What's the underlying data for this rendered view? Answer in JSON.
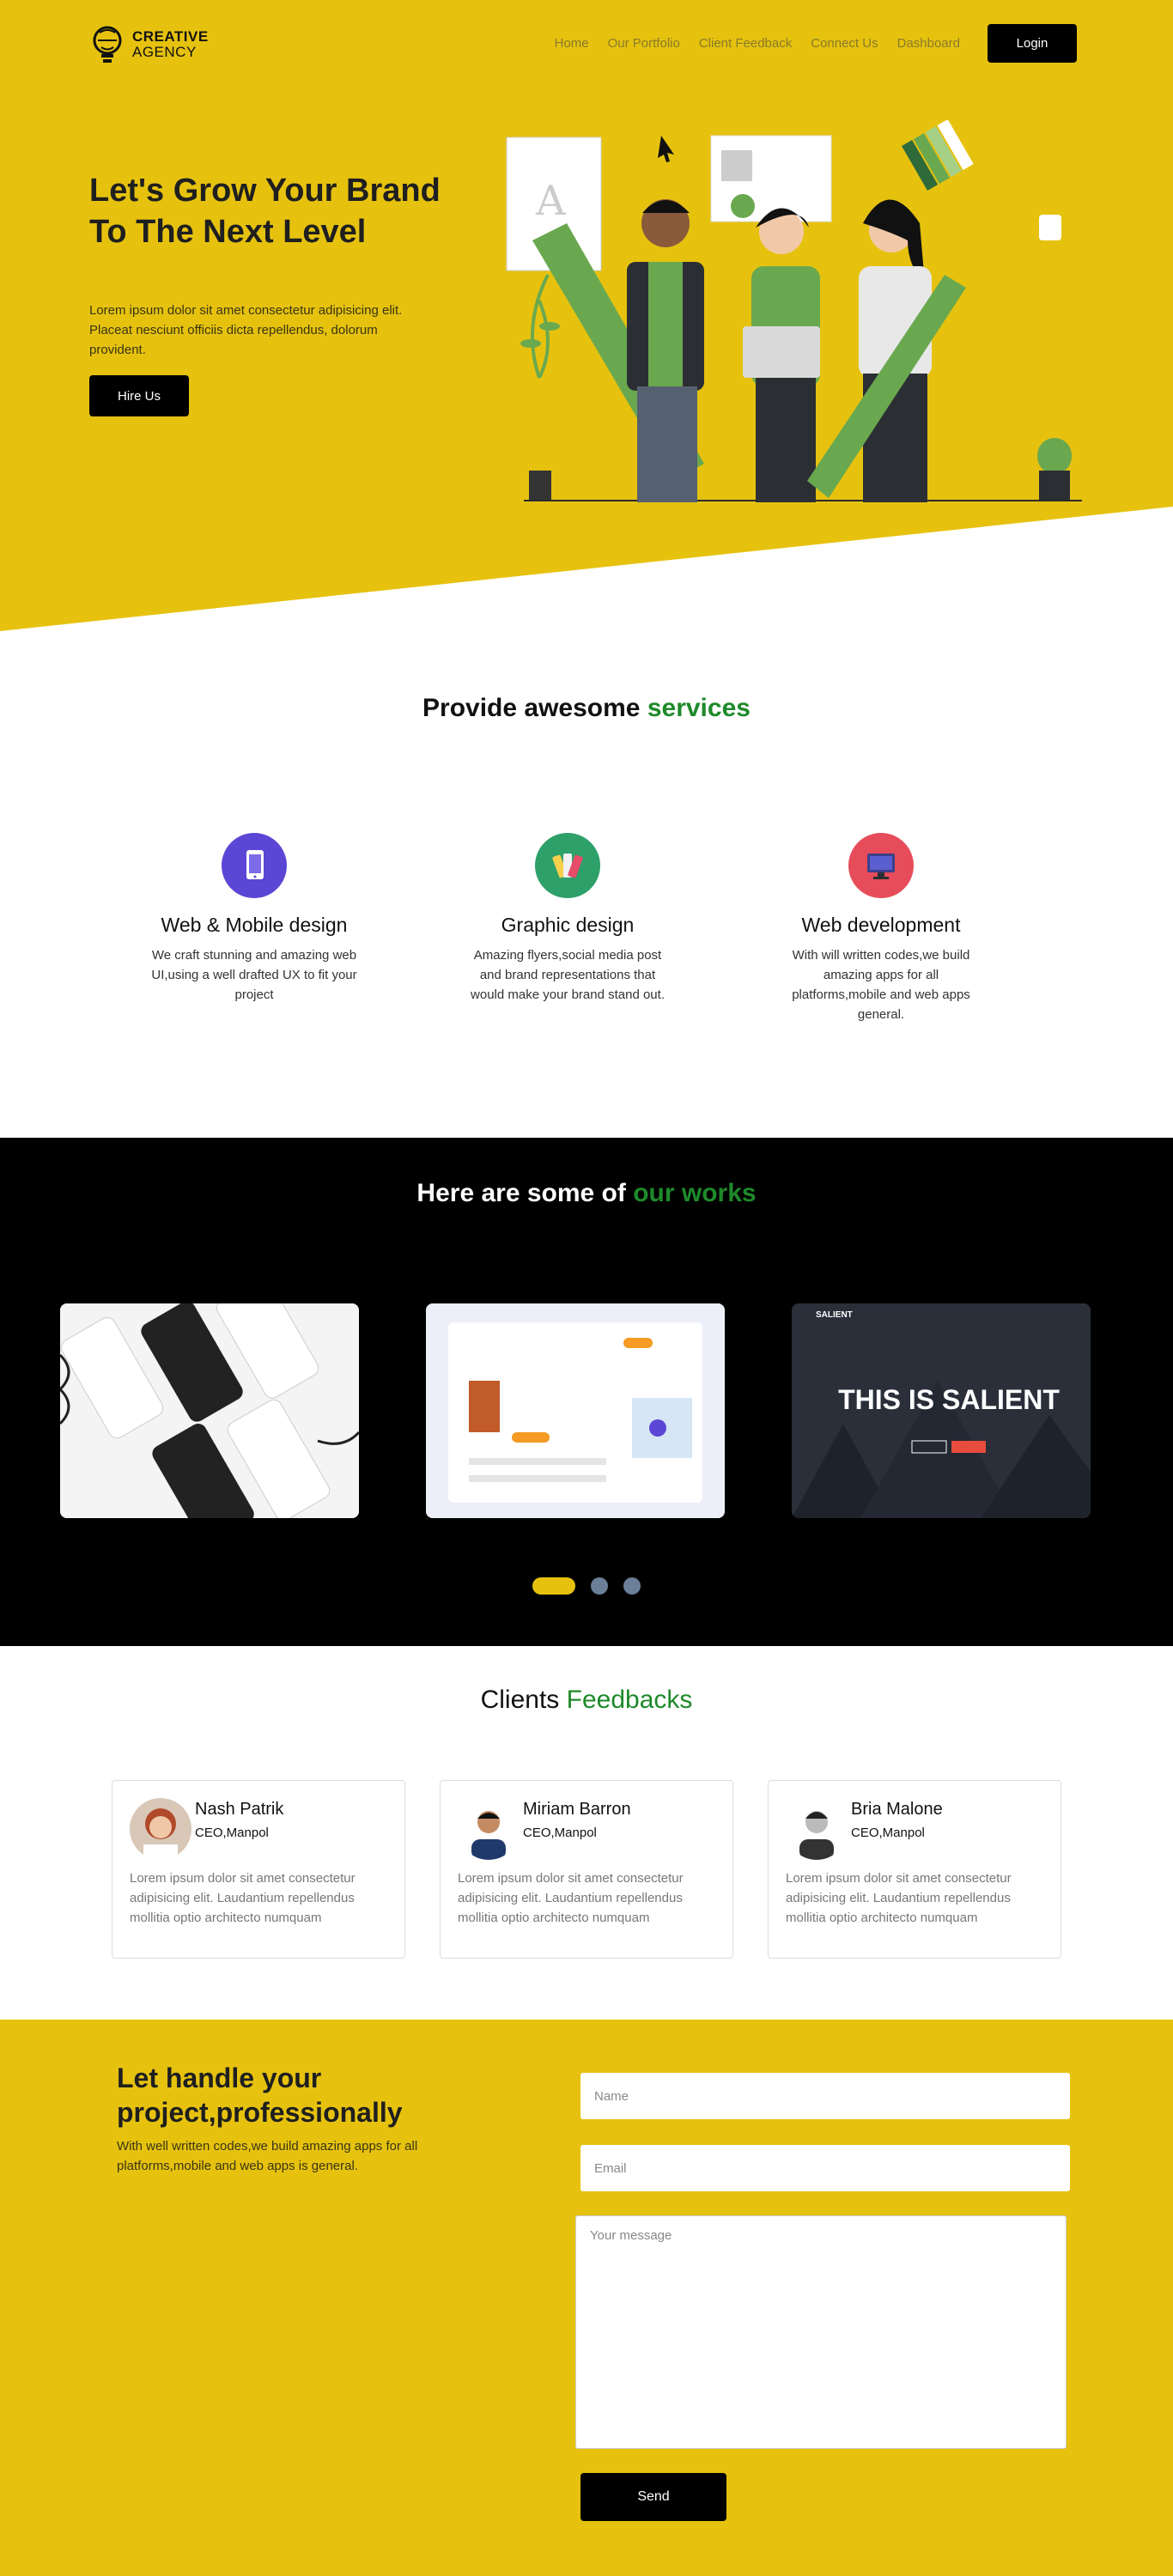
{
  "brand": {
    "line1": "CREATIVE",
    "line2": "AGENCY"
  },
  "nav": {
    "items": [
      "Home",
      "Our Portfolio",
      "Client Feedback",
      "Connect Us",
      "Dashboard"
    ],
    "login_label": "Login"
  },
  "hero": {
    "title": "Let's Grow Your Brand To The Next Level",
    "description": "Lorem ipsum dolor sit amet consectetur adipisicing elit. Placeat nesciunt officiis dicta repellendus, dolorum provident.",
    "cta_label": "Hire Us"
  },
  "services": {
    "title_main": "Provide awesome ",
    "title_accent": "services",
    "items": [
      {
        "title": "Web & Mobile design",
        "text": "We craft stunning and amazing web UI,using a well drafted UX to fit your project",
        "icon": "mobile-design-icon"
      },
      {
        "title": "Graphic design",
        "text": "Amazing flyers,social media post and brand representations that would make your brand stand out.",
        "icon": "color-palette-icon"
      },
      {
        "title": "Web development",
        "text": "With will written codes,we build amazing apps for all platforms,mobile and web apps general.",
        "icon": "monitor-code-icon"
      }
    ]
  },
  "works": {
    "title_main": "Here are some of ",
    "title_accent": "our works",
    "card3_heading": "THIS IS SALIENT",
    "card3_brand": "SALIENT"
  },
  "feedback": {
    "title_main": "Clients ",
    "title_accent": "Feedbacks",
    "items": [
      {
        "name": "Nash Patrik",
        "role": "CEO,Manpol",
        "text": "Lorem ipsum dolor sit amet consectetur adipisicing elit. Laudantium repellendus mollitia optio architecto numquam"
      },
      {
        "name": "Miriam Barron",
        "role": "CEO,Manpol",
        "text": "Lorem ipsum dolor sit amet consectetur adipisicing elit. Laudantium repellendus mollitia optio architecto numquam"
      },
      {
        "name": "Bria Malone",
        "role": "CEO,Manpol",
        "text": "Lorem ipsum dolor sit amet consectetur adipisicing elit. Laudantium repellendus mollitia optio architecto numquam"
      }
    ]
  },
  "contact": {
    "title": "Let handle your project,professionally",
    "description": "With well written codes,we build amazing apps for all platforms,mobile and web apps is general.",
    "name_placeholder": "Name",
    "email_placeholder": "Email",
    "message_placeholder": "Your message",
    "send_label": "Send"
  },
  "colors": {
    "accent": "#e6c20f",
    "highlight": "#1e8a2a",
    "dark": "#000000"
  }
}
